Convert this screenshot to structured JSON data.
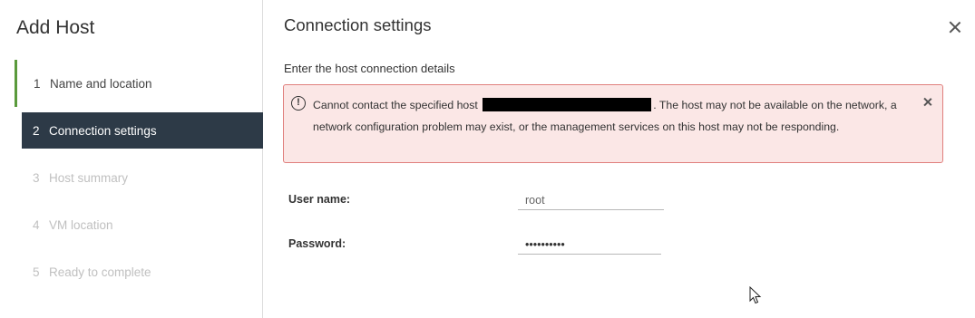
{
  "dialog": {
    "title": "Add Host"
  },
  "steps": [
    {
      "num": "1",
      "label": "Name and location",
      "state": "done"
    },
    {
      "num": "2",
      "label": "Connection settings",
      "state": "active"
    },
    {
      "num": "3",
      "label": "Host summary",
      "state": "future"
    },
    {
      "num": "4",
      "label": "VM location",
      "state": "future"
    },
    {
      "num": "5",
      "label": "Ready to complete",
      "state": "future"
    }
  ],
  "main": {
    "title": "Connection settings",
    "subtitle": "Enter the host connection details",
    "close_icon": "close-icon"
  },
  "alert": {
    "icon": "error-circle-icon",
    "text_before": "Cannot contact the specified host",
    "text_after": ". The host may not be available on the network, a network configuration problem may exist, or the management services on this host may not be responding.",
    "close_icon": "close-icon"
  },
  "form": {
    "username_label": "User name:",
    "username_value": "root",
    "password_label": "Password:",
    "password_value": "••••••••••"
  },
  "colors": {
    "active_step_bg": "#2d3a47",
    "done_step_marker": "#5a9a3c",
    "alert_bg": "#fbe7e6",
    "alert_border": "#e07f7d"
  }
}
